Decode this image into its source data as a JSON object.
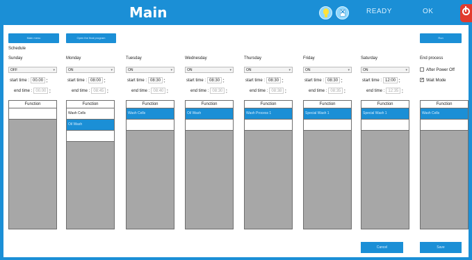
{
  "header": {
    "title": "Main",
    "status_ready": "READY",
    "status_ok": "OK"
  },
  "toolbar": {
    "main_menu_label": "Main menu",
    "open_program_label": "Open the final program",
    "run_label": "Run"
  },
  "schedule": {
    "label": "Schedule",
    "function_header": "Function",
    "start_label": "start time :",
    "end_label": "end time :",
    "days": [
      {
        "label": "Sunday",
        "state": "OFF",
        "start": "00.00",
        "end": "00.00",
        "functions": [],
        "selected": []
      },
      {
        "label": "Monday",
        "state": "ON",
        "start": "08:00",
        "end": "08:45",
        "functions": [
          "Wash Cells",
          "Oil Wash"
        ],
        "selected": [
          1
        ]
      },
      {
        "label": "Tuesday",
        "state": "ON",
        "start": "08:30",
        "end": "08:40",
        "functions": [
          "Wash Cells"
        ],
        "selected": [
          0
        ]
      },
      {
        "label": "Wednesday",
        "state": "ON",
        "start": "08:30",
        "end": "08:30",
        "functions": [
          "Oil Wash"
        ],
        "selected": [
          0
        ]
      },
      {
        "label": "Thursday",
        "state": "ON",
        "start": "08:30",
        "end": "08:38",
        "functions": [
          "Wash Process 1"
        ],
        "selected": [
          0
        ]
      },
      {
        "label": "Friday",
        "state": "ON",
        "start": "08:30",
        "end": "08:35",
        "functions": [
          "Special Wash 1"
        ],
        "selected": [
          0
        ]
      },
      {
        "label": "Saturday",
        "state": "ON",
        "start": "12:00",
        "end": "12:35",
        "functions": [
          "Special Wash 1"
        ],
        "selected": [
          0
        ]
      }
    ]
  },
  "end_process": {
    "label": "End process",
    "function_header": "Function",
    "after_power_off": "After Power Off",
    "wait_mode": "Wait Mode",
    "after_power_off_checked": false,
    "wait_mode_checked": true,
    "functions": [
      "Wash Cells"
    ],
    "selected": [
      0
    ]
  },
  "footer": {
    "cancel_label": "Cancel",
    "save_label": "Save"
  },
  "colors": {
    "accent": "#1b8fd6",
    "table_bg": "#a7a7a7",
    "power": "#e23b2e"
  },
  "icons": {
    "bulb": "lightbulb-icon",
    "doc": "document-icon",
    "power": "power-icon"
  }
}
